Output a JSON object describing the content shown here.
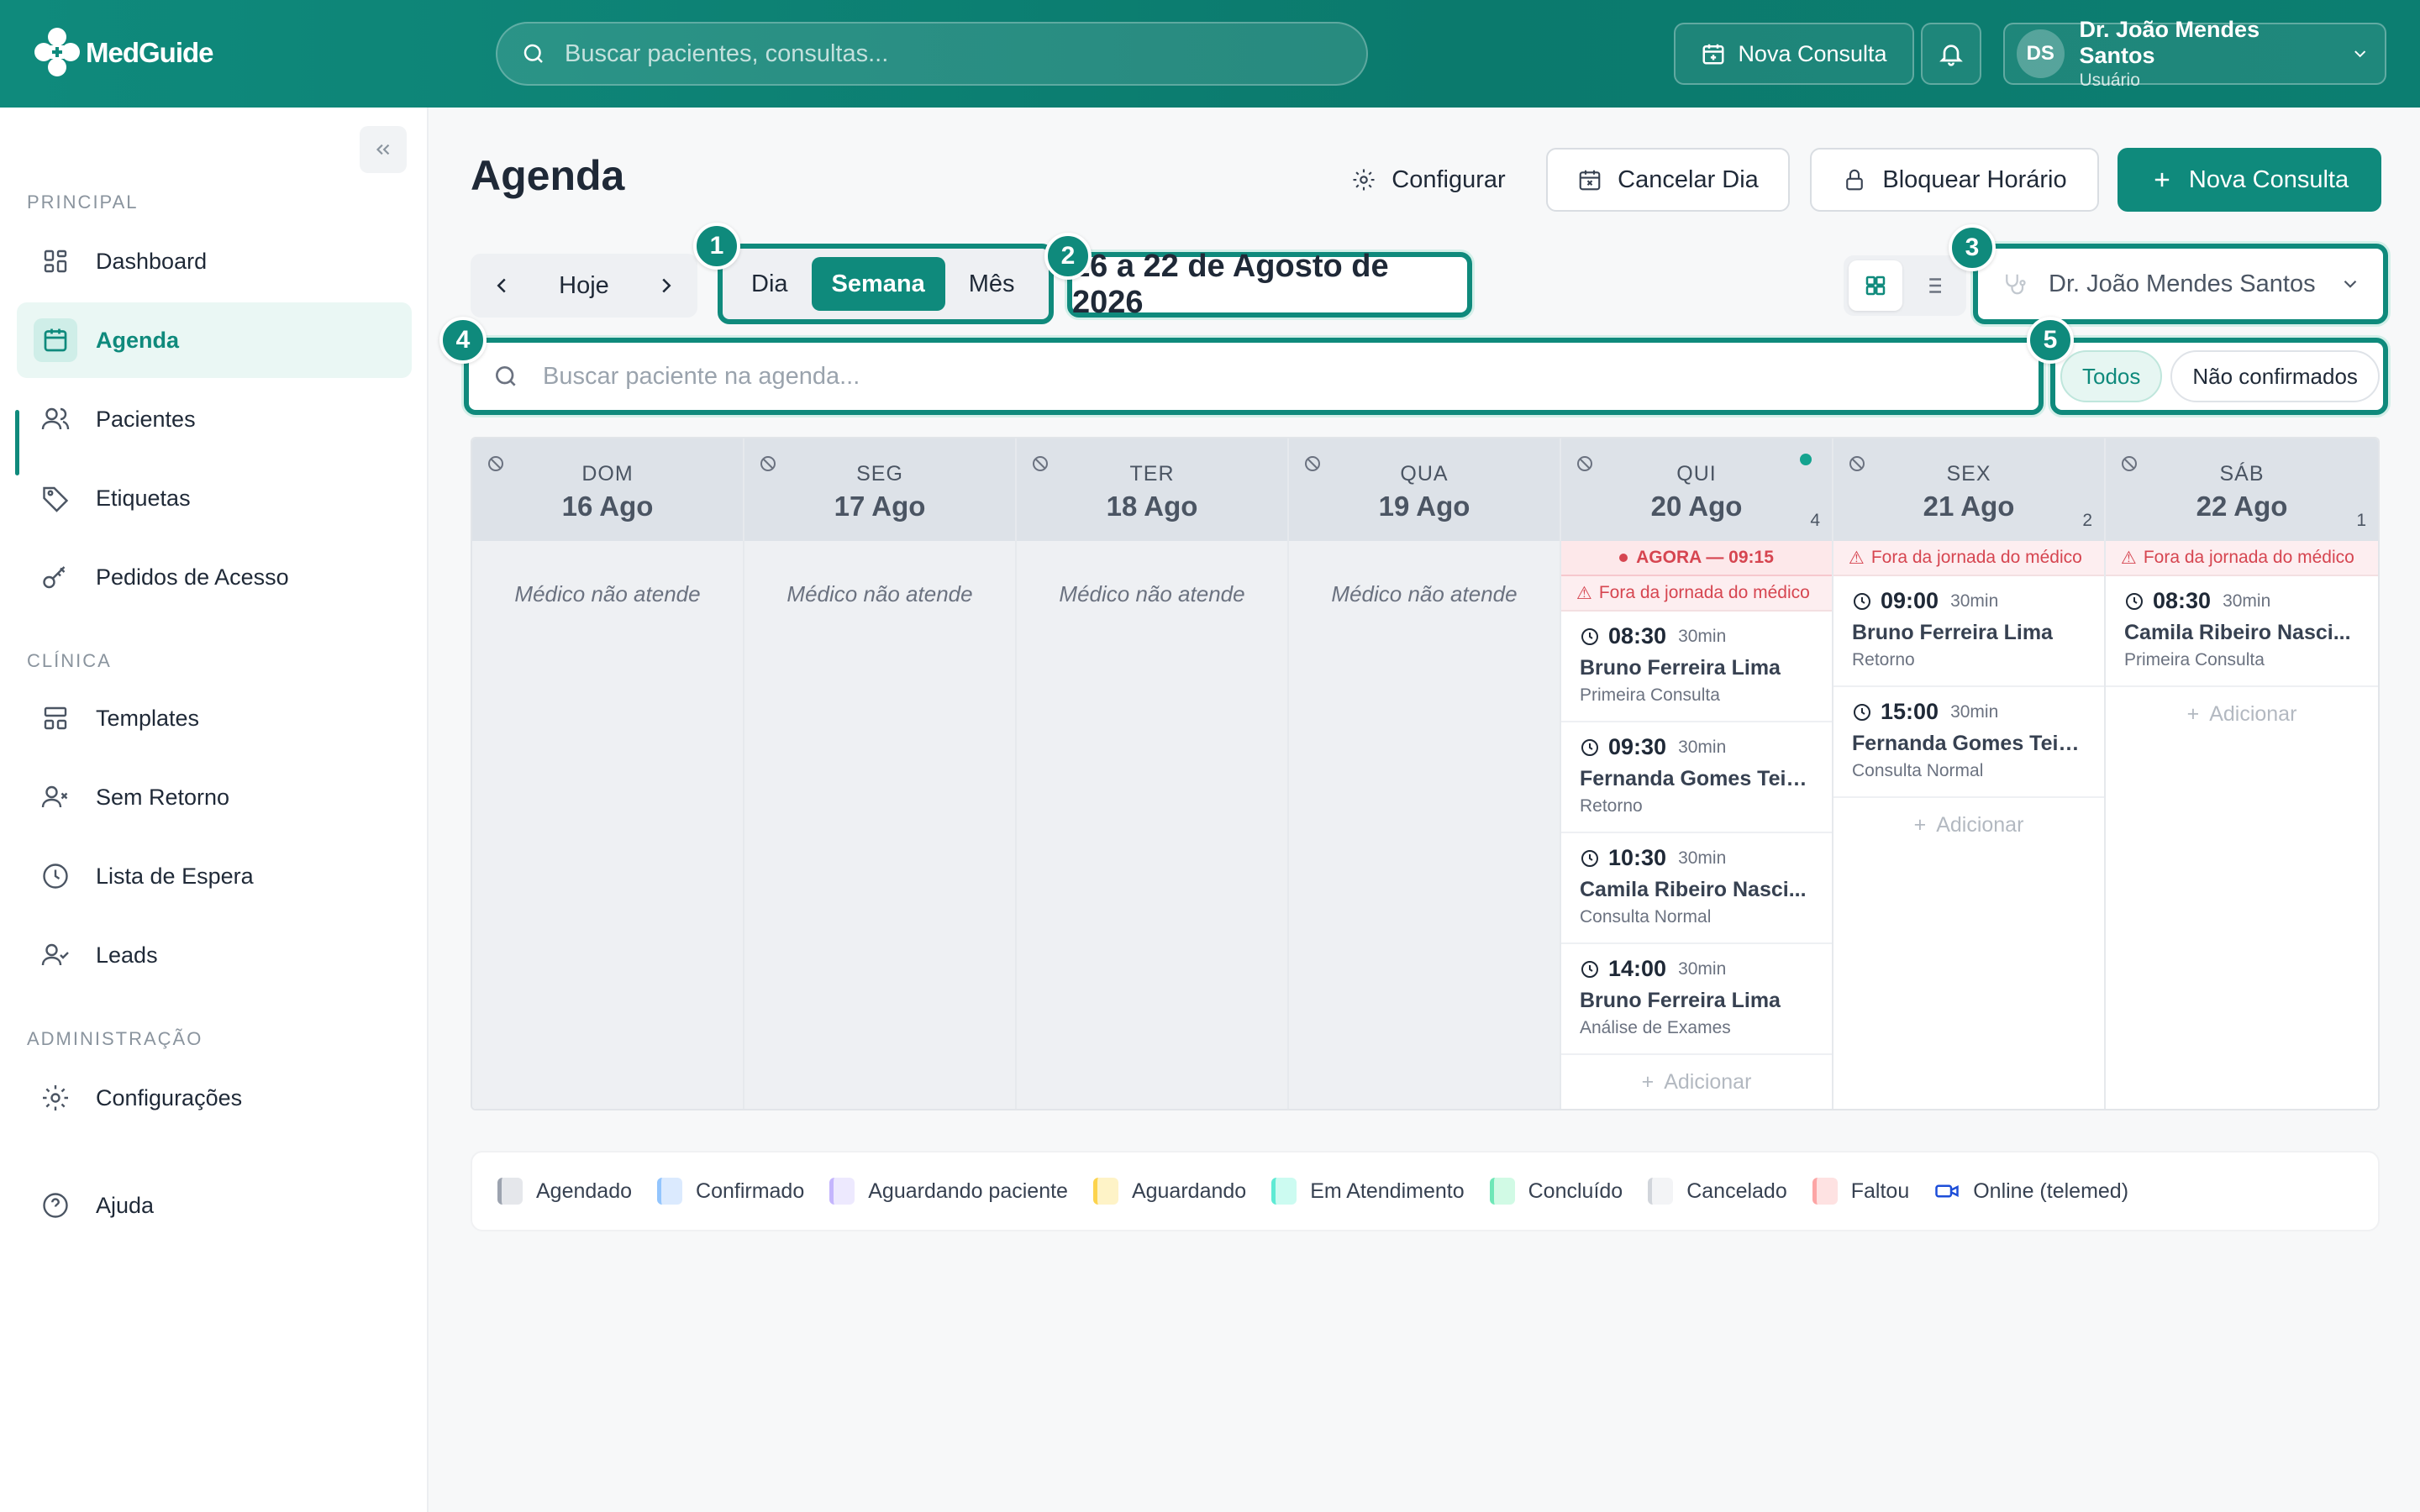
{
  "app": {
    "name": "MedGuide"
  },
  "topbar": {
    "search_placeholder": "Buscar pacientes, consultas...",
    "new_consult_label": "Nova Consulta",
    "user": {
      "initials": "DS",
      "name": "Dr. João Mendes Santos",
      "role": "Usuário"
    }
  },
  "sidebar": {
    "sections": [
      {
        "title": "PRINCIPAL",
        "items": [
          {
            "label": "Dashboard",
            "icon": "dashboard-icon"
          },
          {
            "label": "Agenda",
            "icon": "calendar-icon",
            "active": true
          },
          {
            "label": "Pacientes",
            "icon": "users-icon"
          },
          {
            "label": "Etiquetas",
            "icon": "tag-icon"
          },
          {
            "label": "Pedidos de Acesso",
            "icon": "key-icon"
          }
        ]
      },
      {
        "title": "CLÍNICA",
        "items": [
          {
            "label": "Templates",
            "icon": "layout-icon"
          },
          {
            "label": "Sem Retorno",
            "icon": "user-x-icon"
          },
          {
            "label": "Lista de Espera",
            "icon": "clock-icon"
          },
          {
            "label": "Leads",
            "icon": "user-check-icon"
          }
        ]
      },
      {
        "title": "ADMINISTRAÇÃO",
        "items": [
          {
            "label": "Configurações",
            "icon": "gear-icon"
          }
        ]
      }
    ],
    "help_label": "Ajuda"
  },
  "page": {
    "title": "Agenda",
    "actions": {
      "configure": "Configurar",
      "cancel_day": "Cancelar Dia",
      "block_time": "Bloquear Horário",
      "new_consult": "Nova Consulta"
    },
    "today_label": "Hoje",
    "view_tabs": [
      "Dia",
      "Semana",
      "Mês"
    ],
    "active_view": "Semana",
    "date_range": "16 a 22 de Agosto de 2026",
    "doctor_select": "Dr. João Mendes Santos",
    "agenda_search_placeholder": "Buscar paciente na agenda...",
    "filters": [
      "Todos",
      "Não confirmados"
    ],
    "active_filter": "Todos",
    "markers": [
      "1",
      "2",
      "3",
      "4",
      "5"
    ]
  },
  "calendar": {
    "not_attending_text": "Médico não atende",
    "now_label": "AGORA — 09:15",
    "off_hours_label": "Fora da jornada do médico",
    "add_label": "Adicionar",
    "days": [
      {
        "dow": "DOM",
        "date": "16 Ago",
        "attends": false
      },
      {
        "dow": "SEG",
        "date": "17 Ago",
        "attends": false
      },
      {
        "dow": "TER",
        "date": "18 Ago",
        "attends": false
      },
      {
        "dow": "QUA",
        "date": "19 Ago",
        "attends": false
      },
      {
        "dow": "QUI",
        "date": "20 Ago",
        "attends": true,
        "count": "4",
        "today": true,
        "appointments": [
          {
            "time": "08:30",
            "duration": "30min",
            "patient": "Bruno Ferreira Lima",
            "type": "Primeira Consulta"
          },
          {
            "time": "09:30",
            "duration": "30min",
            "patient": "Fernanda Gomes Teix...",
            "type": "Retorno"
          },
          {
            "time": "10:30",
            "duration": "30min",
            "patient": "Camila Ribeiro Nasci...",
            "type": "Consulta Normal"
          },
          {
            "time": "14:00",
            "duration": "30min",
            "patient": "Bruno Ferreira Lima",
            "type": "Análise de Exames"
          }
        ]
      },
      {
        "dow": "SEX",
        "date": "21 Ago",
        "attends": true,
        "count": "2",
        "appointments": [
          {
            "time": "09:00",
            "duration": "30min",
            "patient": "Bruno Ferreira Lima",
            "type": "Retorno"
          },
          {
            "time": "15:00",
            "duration": "30min",
            "patient": "Fernanda Gomes Teix...",
            "type": "Consulta Normal"
          }
        ]
      },
      {
        "dow": "SÁB",
        "date": "22 Ago",
        "attends": true,
        "count": "1",
        "appointments": [
          {
            "time": "08:30",
            "duration": "30min",
            "patient": "Camila Ribeiro Nasci...",
            "type": "Primeira Consulta"
          }
        ]
      }
    ]
  },
  "legend": [
    {
      "label": "Agendado",
      "color": "#e5e7eb",
      "accent": "#9ca3af"
    },
    {
      "label": "Confirmado",
      "color": "#dbeafe",
      "accent": "#93c5fd"
    },
    {
      "label": "Aguardando paciente",
      "color": "#ede9fe",
      "accent": "#c4b5fd"
    },
    {
      "label": "Aguardando",
      "color": "#fef3c7",
      "accent": "#fcd34d"
    },
    {
      "label": "Em Atendimento",
      "color": "#ccfbf1",
      "accent": "#5eead4"
    },
    {
      "label": "Concluído",
      "color": "#d1fae5",
      "accent": "#6ee7b7"
    },
    {
      "label": "Cancelado",
      "color": "#f3f4f6",
      "accent": "#d1d5db"
    },
    {
      "label": "Faltou",
      "color": "#fee2e2",
      "accent": "#fca5a5"
    },
    {
      "label": "Online (telemed)",
      "icon": "video-icon",
      "color": "#1d4ed8"
    }
  ],
  "colors": {
    "brand": "#0f8a7c",
    "alert": "#d64550"
  }
}
